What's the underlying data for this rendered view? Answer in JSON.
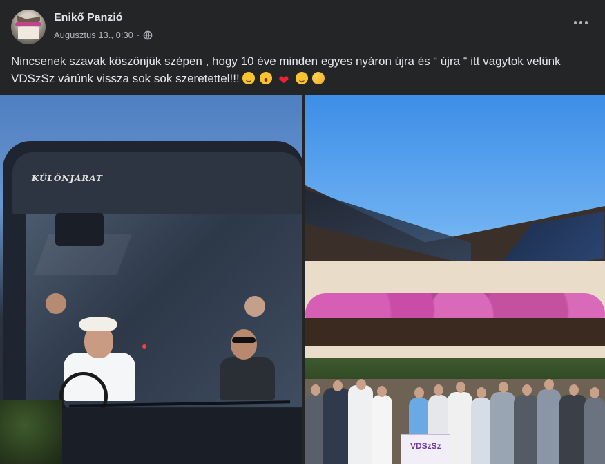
{
  "post": {
    "page_name": "Enikő Panzió",
    "timestamp": "Augusztus 13., 0:30",
    "separator": "·",
    "audience_icon": "globe-icon",
    "more_icon": "more-options-icon",
    "text": "Nincsenek szavak köszönjük szépen , hogy 10 éve minden egyes nyáron újra és “ újra “ itt vagytok velünk VDSzSz várúnk vissza sok sok szeretettel!!!",
    "emojis": [
      "smiling-face-icon",
      "face-with-open-mouth-icon",
      "red-heart-icon",
      "winking-face-icon",
      "partying-face-icon"
    ]
  },
  "photos": {
    "left": {
      "description_icon": "bus-photo",
      "sign_text": "KÜLÖNJÁRAT"
    },
    "right": {
      "description_icon": "group-photo",
      "banner_text": "VDSzSz"
    }
  },
  "colors": {
    "background": "#242526",
    "text_primary": "#e4e6eb",
    "text_secondary": "#b0b3b8",
    "heart": "#e8223b"
  }
}
